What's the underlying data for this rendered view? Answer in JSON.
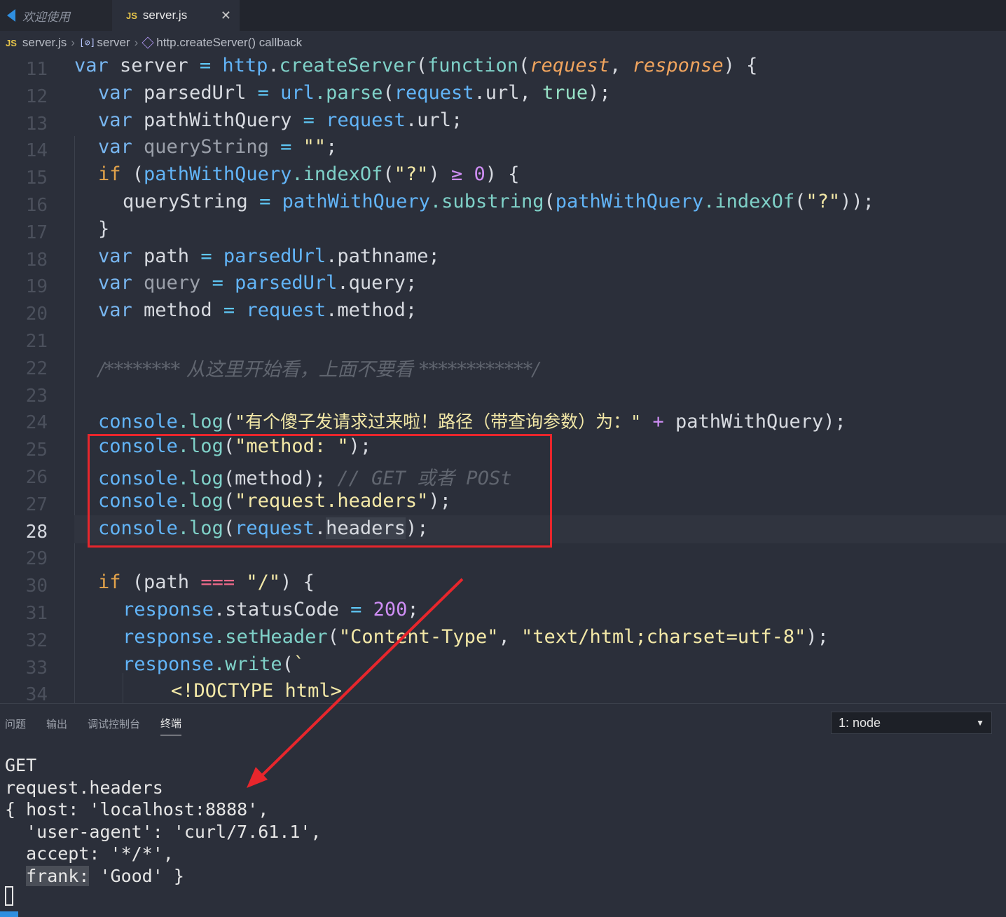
{
  "tabs": [
    {
      "label": "欢迎使用",
      "active": false
    },
    {
      "label": "server.js",
      "active": true,
      "badge": "JS"
    }
  ],
  "breadcrumb": {
    "badge": "JS",
    "file": "server.js",
    "variable": "server",
    "callback": "http.createServer() callback"
  },
  "code": {
    "lines": [
      11,
      12,
      13,
      14,
      15,
      16,
      17,
      18,
      19,
      20,
      21,
      22,
      23,
      24,
      25,
      26,
      27,
      28,
      29,
      30,
      31,
      32,
      33,
      34
    ],
    "current_line": 28,
    "l11": {
      "kw": "var",
      "name": " server ",
      "op": "=",
      "obj": " http",
      "dot": ".",
      "fn": "createServer",
      "p1": "(",
      "kw2": "function",
      "p2": "(",
      "param1": "request",
      "comma": ", ",
      "param2": "response",
      "tail": ") {"
    },
    "l12": {
      "kw": "var",
      "name": " parsedUrl ",
      "op": "=",
      "obj": " url",
      "fn": ".parse",
      "p": "(",
      "obj2": "request",
      "rest": ".url, ",
      "bool": "true",
      "tail": ");"
    },
    "l13": {
      "kw": "var",
      "name": " pathWithQuery ",
      "op": "=",
      "obj": " request",
      "tail": ".url;"
    },
    "l14": {
      "kw": "var",
      "name": " queryString ",
      "op": "=",
      "str": " \"\"",
      "tail": ";"
    },
    "l15": {
      "kw": "if",
      "p": " (",
      "obj": "pathWithQuery",
      "fn": ".indexOf",
      "p2": "(",
      "str": "\"?\"",
      "p3": ") ",
      "op": "≥",
      "num": " 0",
      "tail": ") {"
    },
    "l16": {
      "name": "queryString ",
      "op": "=",
      "obj": " pathWithQuery",
      "fn": ".substring",
      "p": "(",
      "obj2": "pathWithQuery",
      "fn2": ".indexOf",
      "p2": "(",
      "str": "\"?\"",
      "tail": "));"
    },
    "l17": {
      "text": "}"
    },
    "l18": {
      "kw": "var",
      "name": " path ",
      "op": "=",
      "obj": " parsedUrl",
      "tail": ".pathname;"
    },
    "l19": {
      "kw": "var",
      "name": " query ",
      "op": "=",
      "obj": " parsedUrl",
      "tail": ".query;"
    },
    "l20": {
      "kw": "var",
      "name": " method ",
      "op": "=",
      "obj": " request",
      "tail": ".method;"
    },
    "l22": {
      "comment": "/******** 从这里开始看，上面不要看 ************/"
    },
    "l24": {
      "obj": "console",
      "fn": ".log",
      "p": "(",
      "str": "\"有个傻子发请求过来啦！路径（带查询参数）为：\"",
      "op": " + ",
      "tail": "pathWithQuery);"
    },
    "l25": {
      "obj": "console",
      "fn": ".log",
      "p": "(",
      "str": "\"method: \"",
      "tail": ");"
    },
    "l26": {
      "obj": "console",
      "fn": ".log",
      "p": "(method); ",
      "comment": "// GET 或者 POSt"
    },
    "l27": {
      "obj": "console",
      "fn": ".log",
      "p": "(",
      "str": "\"request.headers\"",
      "tail": ");"
    },
    "l28": {
      "obj": "console",
      "fn": ".log",
      "p": "(",
      "obj2": "request",
      "dot": ".",
      "hl": "headers",
      "tail": ");"
    },
    "l30": {
      "kw": "if",
      "p": " (path ",
      "op": "===",
      "str": " \"/\"",
      "tail": ") {"
    },
    "l31": {
      "obj": "response",
      "rest": ".statusCode ",
      "op": "=",
      "num": " 200",
      "tail": ";"
    },
    "l32": {
      "obj": "response",
      "fn": ".setHeader",
      "p": "(",
      "str": "\"Content-Type\"",
      "comma": ", ",
      "str2": "\"text/html;charset=utf-8\"",
      "tail": ");"
    },
    "l33": {
      "obj": "response",
      "fn": ".write",
      "p": "(",
      "str": "`"
    },
    "l34": {
      "str": "<!DOCTYPE html>"
    }
  },
  "panel": {
    "tabs": [
      "问题",
      "输出",
      "调试控制台",
      "终端"
    ],
    "active_tab": "终端",
    "terminal_select": "1: node"
  },
  "terminal": {
    "lines": [
      "GET",
      "request.headers",
      "{ host: 'localhost:8888',",
      "  'user-agent': 'curl/7.61.1',",
      "  accept: '*/*',"
    ],
    "last_indent": "  ",
    "last_key": "frank:",
    "last_rest": " 'Good' }"
  },
  "colors": {
    "highlight_box": "#e8262c",
    "arrow": "#e8262c",
    "background": "#2b2f3a"
  }
}
